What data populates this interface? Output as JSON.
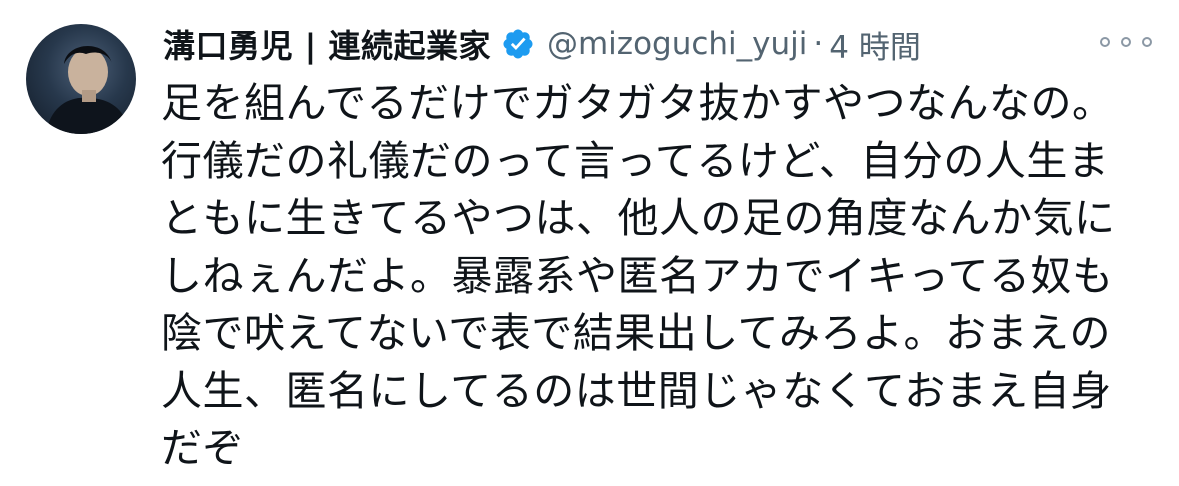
{
  "author": {
    "display_name": "溝口勇児 | 連続起業家",
    "handle": "@mizoguchi_yuji",
    "separator": "·",
    "time": "4 時間"
  },
  "icons": {
    "avatar": "profile-photo",
    "verified": "verified-badge-icon",
    "more": "more-options-icon"
  },
  "colors": {
    "verified": "#1d9bf0",
    "text": "#0f1419",
    "secondary": "#536471"
  },
  "tweet": {
    "lines": [
      "足を組んでるだけでガタガタ抜かすやつなんなの。",
      "行儀だの礼儀だのって言ってるけど、自分の人生ま",
      "ともに生きてるやつは、他人の足の角度なんか気に",
      "しねぇんだよ。暴露系や匿名アカでイキってる奴も",
      "陰で吠えてないで表で結果出してみろよ。おまえの",
      "人生、匿名にしてるのは世間じゃなくておまえ自身",
      "だぞ"
    ]
  }
}
